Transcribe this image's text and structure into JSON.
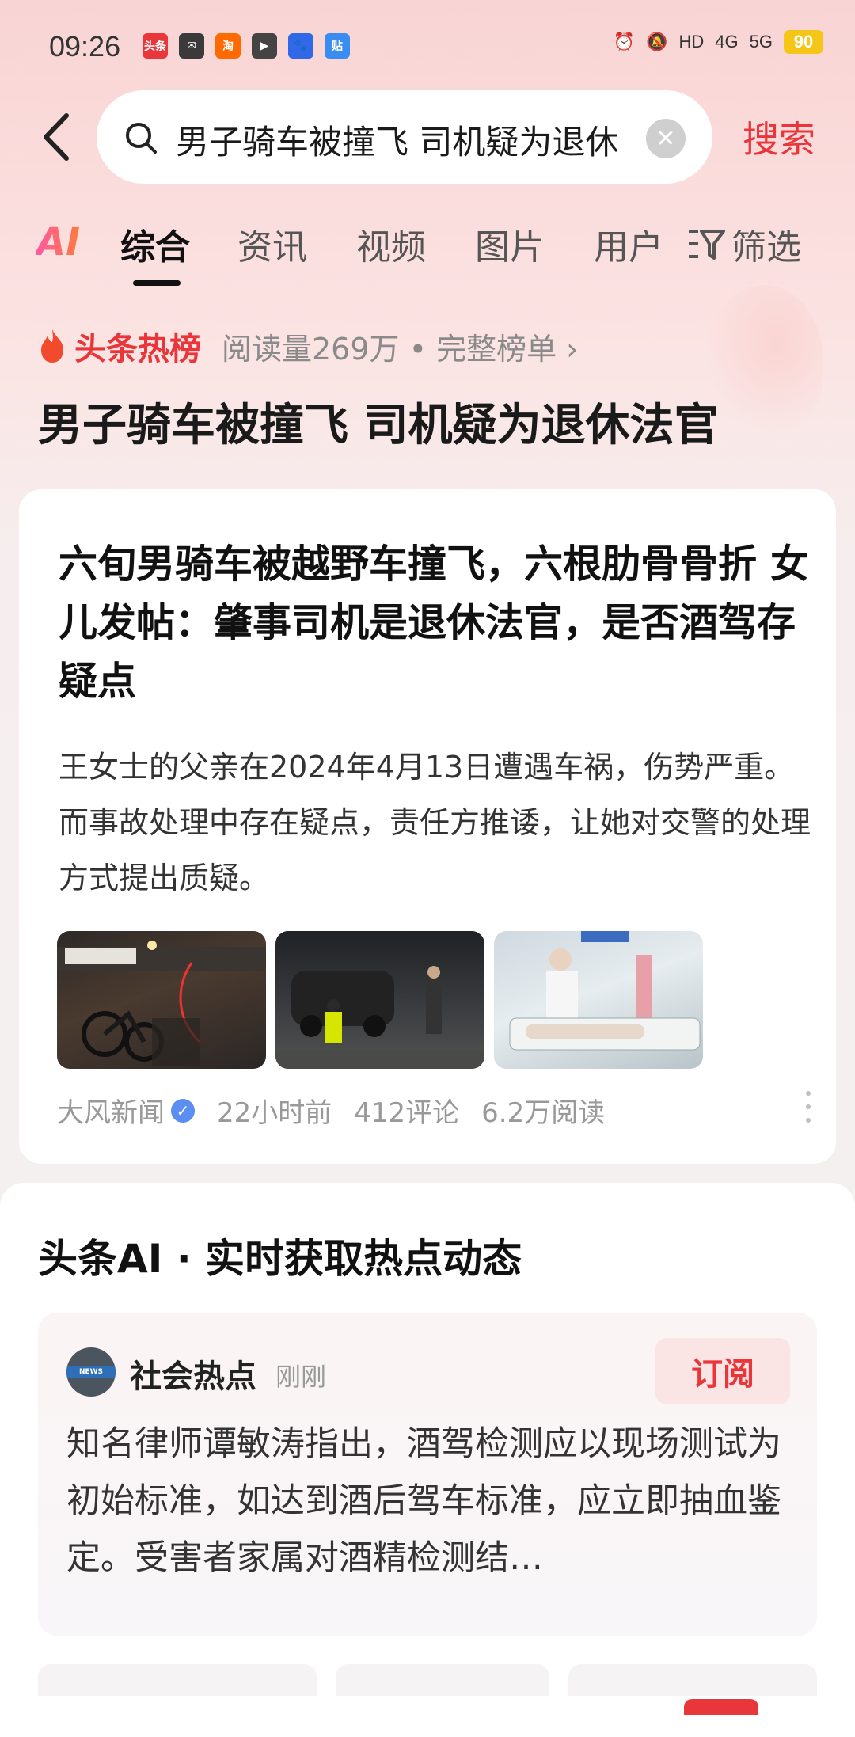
{
  "status_bar": {
    "time": "09:26",
    "app_icons": [
      {
        "name": "toutiao-icon",
        "label": "头条",
        "color": "#e9363a"
      },
      {
        "name": "mail-icon",
        "label": "✉",
        "color": "#3a3a3a"
      },
      {
        "name": "taobao-icon",
        "label": "淘",
        "color": "#ff6a00"
      },
      {
        "name": "video-icon",
        "label": "▶",
        "color": "#444"
      },
      {
        "name": "baidu-icon",
        "label": "🐾",
        "color": "#3068e8"
      },
      {
        "name": "tieba-icon",
        "label": "贴",
        "color": "#3b8cf0"
      }
    ],
    "network_labels": [
      "HD",
      "4G",
      "5G"
    ],
    "battery": "90"
  },
  "search": {
    "query": "男子骑车被撞飞 司机疑为退休法官",
    "button_label": "搜索"
  },
  "tabs": {
    "ai_label": "AI",
    "items": [
      "综合",
      "资讯",
      "视频",
      "图片",
      "用户"
    ],
    "active": "综合",
    "filter_label": "筛选"
  },
  "hot": {
    "label": "头条热榜",
    "meta": "阅读量269万 • 完整榜单 ›",
    "title": "男子骑车被撞飞 司机疑为退休法官"
  },
  "article": {
    "title": "六旬男骑车被越野车撞飞，六根肋骨骨折 女儿发帖：肇事司机是退休法官，是否酒驾存疑点",
    "summary": "王女士的父亲在2024年4月13日遭遇车祸，伤势严重。而事故处理中存在疑点，责任方推诿，让她对交警的处理方式提出质疑。",
    "source": "大风新闻",
    "time": "22小时前",
    "comments": "412评论",
    "reads": "6.2万阅读"
  },
  "ai_section": {
    "title": "头条AI · 实时获取热点动态",
    "card": {
      "source_name": "社会热点",
      "time": "刚刚",
      "subscribe_label": "订阅",
      "text": "知名律师谭敏涛指出，酒驾检测应以现场测试为初始标准，如达到酒后驾车标准，应立即抽血鉴定。受害者家属对酒精检测结…"
    }
  }
}
